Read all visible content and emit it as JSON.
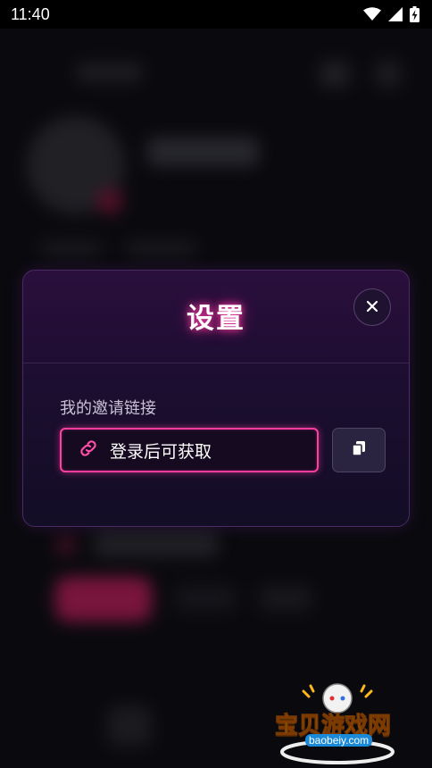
{
  "status_bar": {
    "time": "11:40"
  },
  "dialog": {
    "title": "设置",
    "invite_label": "我的邀请链接",
    "invite_value": "登录后可获取"
  },
  "watermark": {
    "brand": "宝贝游戏网",
    "url": "baobeiy.com"
  },
  "colors": {
    "accent": "#ff3fa0",
    "dialog_bg": "#1c0e30"
  },
  "icons": [
    "wifi-icon",
    "signal-icon",
    "battery-icon",
    "close-icon",
    "link-icon",
    "copy-icon"
  ]
}
